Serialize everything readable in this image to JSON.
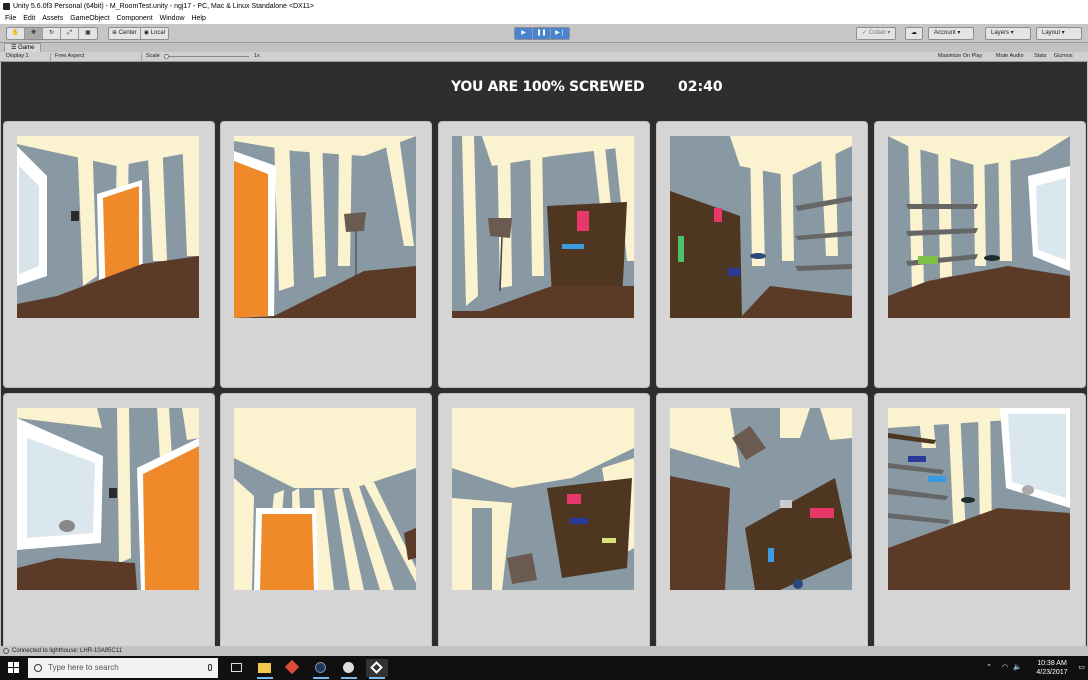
{
  "window": {
    "title": "Unity 5.6.0f3 Personal (64bit) - M_RoomTest.unity - ngj17 - PC, Mac & Linux Standalone <DX11>"
  },
  "menu": [
    "File",
    "Edit",
    "Assets",
    "GameObject",
    "Component",
    "Window",
    "Help"
  ],
  "toolbar": {
    "tools": [
      "hand-icon",
      "move-icon",
      "rotate-icon",
      "scale-icon",
      "rect-icon"
    ],
    "pivot_label": "Center",
    "space_label": "Local",
    "collab_label": "Collab",
    "account_label": "Account",
    "layers_label": "Layers",
    "layout_label": "Layout"
  },
  "game_tab": {
    "label": "Game",
    "display": "Display 1",
    "aspect": "Free Aspect",
    "scale_label": "Scale",
    "scale_value": "1x",
    "maximize": "Maximize On Play",
    "mute": "Mute Audio",
    "stats": "Stats",
    "gizmos": "Gizmos"
  },
  "hud": {
    "status": "YOU ARE 100% SCREWED",
    "timer": "02:40"
  },
  "camera_views": [
    {
      "id": "view-1"
    },
    {
      "id": "view-2"
    },
    {
      "id": "view-3"
    },
    {
      "id": "view-4"
    },
    {
      "id": "view-5"
    },
    {
      "id": "view-6"
    },
    {
      "id": "view-7"
    },
    {
      "id": "view-8"
    },
    {
      "id": "view-9"
    },
    {
      "id": "view-10"
    }
  ],
  "statusbar": {
    "message": "Connected to lighthouse: LHR-10A85C11"
  },
  "taskbar": {
    "search_placeholder": "Type here to search",
    "time": "10:38 AM",
    "date": "4/23/2017"
  },
  "colors": {
    "wall_blue": "#8899a3",
    "wall_cream": "#fbf3cf",
    "floor": "#5c3a28",
    "door": "#ef8a2a",
    "accent_play": "#4a84d1"
  }
}
